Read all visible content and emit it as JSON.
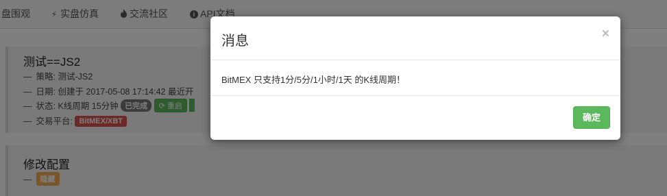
{
  "nav": {
    "items": [
      {
        "label": "盘围观",
        "icon": ""
      },
      {
        "label": "实盘仿真",
        "icon": "bolt-icon"
      },
      {
        "label": "交流社区",
        "icon": "fire-icon"
      },
      {
        "label": "API文档",
        "icon": "info-circle-icon"
      }
    ]
  },
  "robot": {
    "title": "测试==JS2",
    "dash": "—",
    "strategy": "策略: 测试-JS2",
    "date": "日期: 创建于 2017-05-08 17:14:42 最近开",
    "status_prefix": "状态: K线周期 15分钟",
    "status_badge": "已完成",
    "restart_label": "重启",
    "exchange_prefix": "交易平台:",
    "exchange_label": "BitMEX/XBT"
  },
  "config": {
    "title": "修改配置",
    "dash": "—",
    "hide_label": "隐藏"
  },
  "modal": {
    "title": "消息",
    "close_symbol": "×",
    "message": "BitMEX 只支持1分/5分/1小时/1天 的K线周期！",
    "ok_label": "确定"
  },
  "colors": {
    "primary_green": "#5cb85c",
    "danger_red": "#d9534f",
    "warning_orange": "#f0ad4e",
    "backdrop": "rgba(0,0,0,0.5)"
  }
}
